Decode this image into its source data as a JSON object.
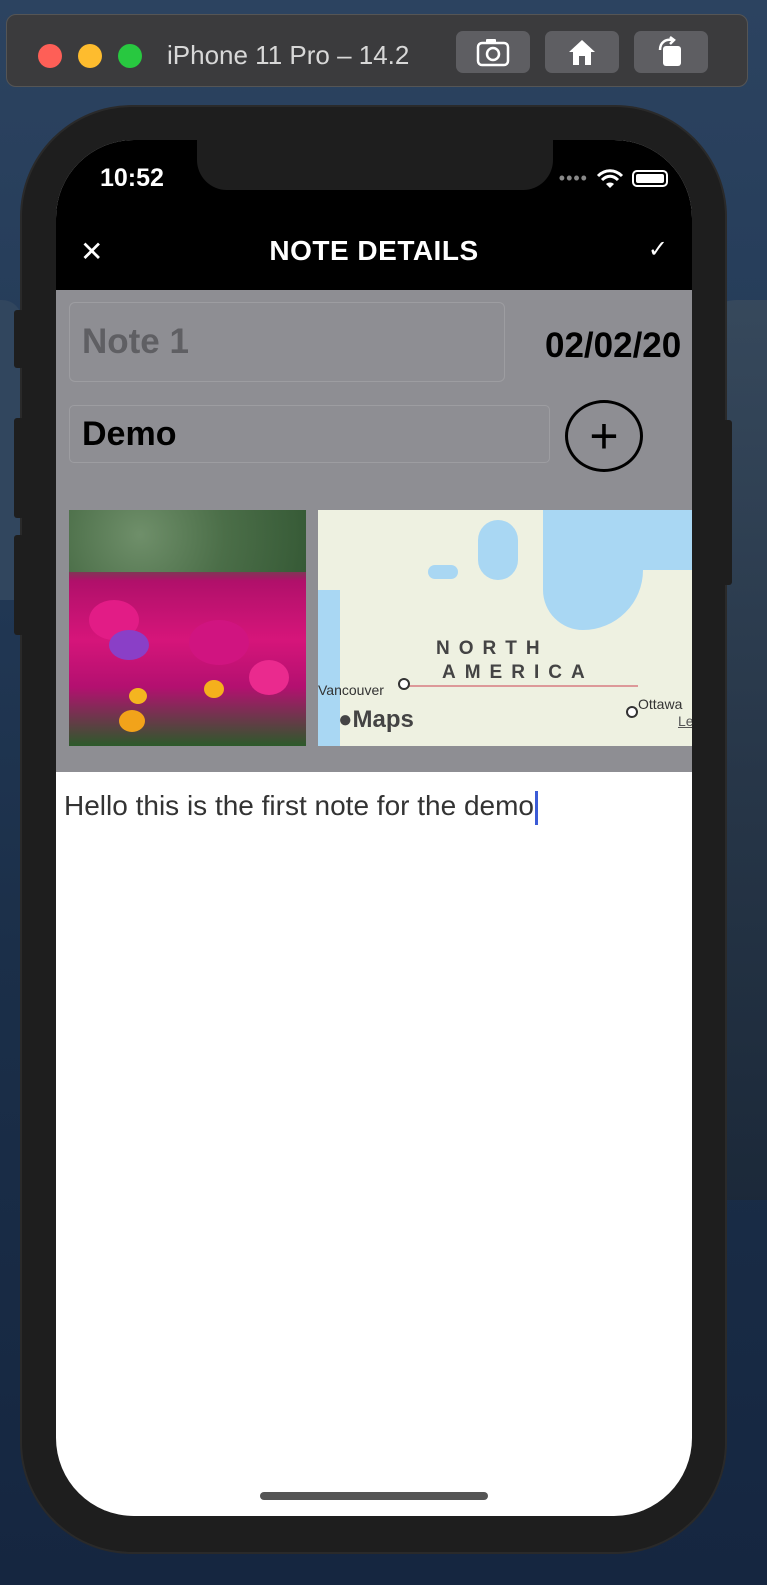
{
  "simulator": {
    "title": "iPhone 11 Pro – 14.2",
    "buttons": [
      "screenshot-icon",
      "home-icon",
      "rotate-icon"
    ]
  },
  "status_bar": {
    "time": "10:52",
    "signal": "••••",
    "icons": [
      "wifi-icon",
      "battery-icon"
    ]
  },
  "nav": {
    "title": "NOTE DETAILS",
    "close": "✕",
    "save": "✓"
  },
  "form": {
    "title_placeholder": "Note 1",
    "date": "02/02/20",
    "category": "Demo",
    "add": "+"
  },
  "media": {
    "photo": "flower-photo",
    "map": {
      "label_line1": "NORTH",
      "label_line2": "AMERICA",
      "city1": "Vancouver",
      "city2": "Ottawa",
      "legal": "Le",
      "attribution": "Maps"
    }
  },
  "note": {
    "body": "Hello this is the first note for the demo"
  },
  "colors": {
    "header": "#000000",
    "panel": "#8e8e93",
    "cursor": "#3b5bd6"
  }
}
